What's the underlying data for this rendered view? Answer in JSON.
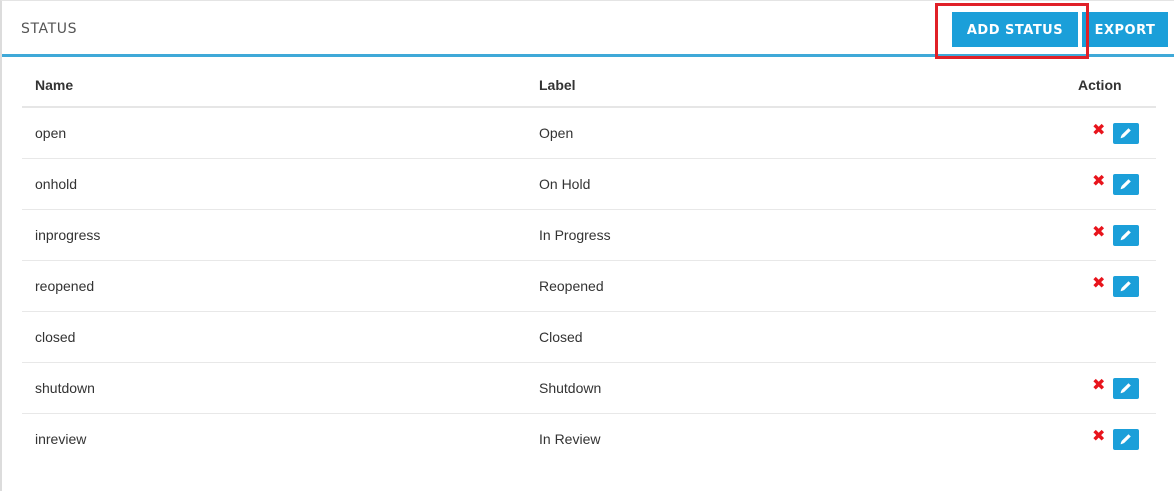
{
  "header": {
    "title": "STATUS",
    "add_label": "ADD STATUS",
    "export_label": "EXPORT"
  },
  "table": {
    "columns": [
      "Name",
      "Label",
      "Action"
    ],
    "rows": [
      {
        "name": "open",
        "label": "Open",
        "deletable": true,
        "editable": true
      },
      {
        "name": "onhold",
        "label": "On Hold",
        "deletable": true,
        "editable": true
      },
      {
        "name": "inprogress",
        "label": "In Progress",
        "deletable": true,
        "editable": true
      },
      {
        "name": "reopened",
        "label": "Reopened",
        "deletable": true,
        "editable": true
      },
      {
        "name": "closed",
        "label": "Closed",
        "deletable": false,
        "editable": false
      },
      {
        "name": "shutdown",
        "label": "Shutdown",
        "deletable": true,
        "editable": true
      },
      {
        "name": "inreview",
        "label": "In Review",
        "deletable": true,
        "editable": true
      }
    ]
  },
  "icons": {
    "delete": "close-icon",
    "edit": "pencil-icon"
  },
  "colors": {
    "accent": "#1b9fd9",
    "header_rule": "#3fa9d8",
    "delete": "#e8141c",
    "highlight": "#e02028"
  }
}
